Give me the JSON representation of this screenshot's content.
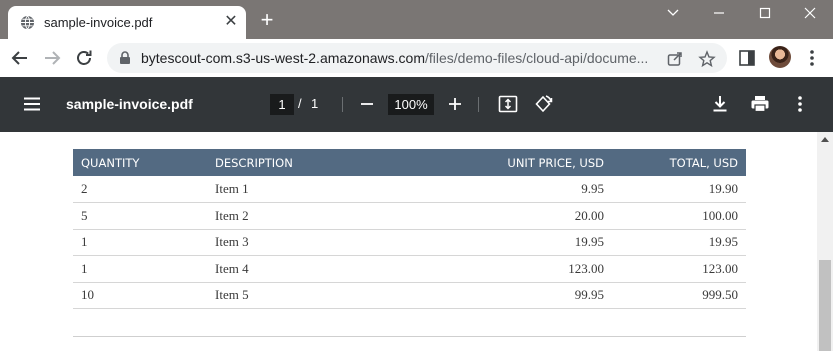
{
  "browser": {
    "tab": {
      "title": "sample-invoice.pdf"
    },
    "omnibox": {
      "host": "bytescout-com.s3-us-west-2.amazonaws.com",
      "path": "/files/demo-files/cloud-api/docume..."
    },
    "icons": [
      "globe-icon",
      "close-icon",
      "plus-icon",
      "chevron-down-icon",
      "minimize-icon",
      "maximize-icon",
      "window-close-icon",
      "back-arrow-icon",
      "forward-arrow-icon",
      "reload-icon",
      "lock-icon",
      "share-icon",
      "star-icon",
      "side-panel-icon",
      "kebab-icon"
    ]
  },
  "pdf_viewer": {
    "title": "sample-invoice.pdf",
    "page_current": "1",
    "page_separator": "/",
    "page_total": "1",
    "zoom": "100%",
    "icons": [
      "menu-icon",
      "minus-icon",
      "plus-icon",
      "fit-page-icon",
      "rotate-icon",
      "download-icon",
      "print-icon",
      "more-icon"
    ]
  },
  "invoice_table": {
    "headers": [
      "QUANTITY",
      "DESCRIPTION",
      "UNIT PRICE, USD",
      "TOTAL, USD"
    ],
    "rows": [
      {
        "quantity": "2",
        "description": "Item 1",
        "unit_price": "9.95",
        "total": "19.90"
      },
      {
        "quantity": "5",
        "description": "Item 2",
        "unit_price": "20.00",
        "total": "100.00"
      },
      {
        "quantity": "1",
        "description": "Item 3",
        "unit_price": "19.95",
        "total": "19.95"
      },
      {
        "quantity": "1",
        "description": "Item 4",
        "unit_price": "123.00",
        "total": "123.00"
      },
      {
        "quantity": "10",
        "description": "Item 5",
        "unit_price": "99.95",
        "total": "999.50"
      }
    ]
  },
  "colors": {
    "tabstrip": "#7a7674",
    "pdf_toolbar": "#323639",
    "table_header": "#536a82"
  }
}
